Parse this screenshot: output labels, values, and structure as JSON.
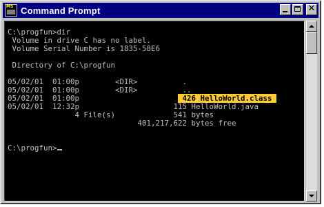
{
  "window": {
    "title": "Command Prompt",
    "icon_text": "MS"
  },
  "console": {
    "lines": [
      {
        "pre": "C:\\progfun>dir"
      },
      {
        "pre": " Volume in drive C has no label."
      },
      {
        "pre": " Volume Serial Number is 1835-58E6"
      },
      {
        "pre": ""
      },
      {
        "pre": " Directory of C:\\progfun"
      },
      {
        "pre": ""
      },
      {
        "pre": "05/02/01  01:00p        <DIR>          ."
      },
      {
        "pre": "05/02/01  01:00p        <DIR>          .."
      },
      {
        "pre": "05/02/01  01:00p",
        "mid": "                      ",
        "hl": " 426 HelloWorld.class "
      },
      {
        "pre": "05/02/01  12:32p                     115 HelloWorld.java"
      },
      {
        "pre": "               4 File(s)             541 bytes"
      },
      {
        "pre": "                             401,217,622 bytes free"
      },
      {
        "pre": ""
      },
      {
        "pre": ""
      },
      {
        "pre": "C:\\progfun>"
      }
    ]
  },
  "colors": {
    "titlebar": "#000080",
    "console_bg": "#000000",
    "console_text": "#c0c0c0",
    "highlight": "#ffcc33"
  },
  "icons": [
    "app-icon",
    "minimize-icon",
    "maximize-icon",
    "close-icon",
    "scroll-up-icon",
    "scroll-down-icon"
  ]
}
